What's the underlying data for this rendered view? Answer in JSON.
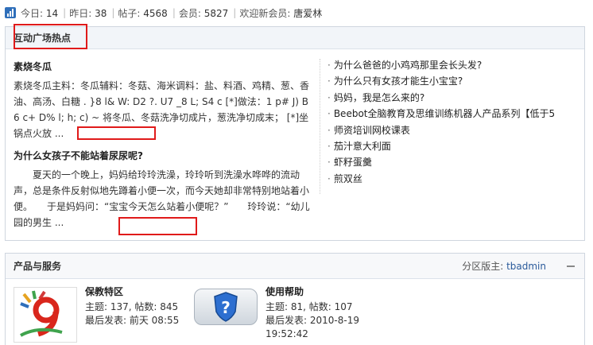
{
  "stats": {
    "today_label": "今日:",
    "today_value": "14",
    "yesterday_label": "昨日:",
    "yesterday_value": "38",
    "posts_label": "帖子:",
    "posts_value": "4568",
    "members_label": "会员:",
    "members_value": "5827",
    "welcome_label": "欢迎新会员:",
    "new_member": "唐爱林"
  },
  "hot": {
    "title": "互动广场热点",
    "post1": {
      "title": "素烧冬瓜",
      "body": "素烧冬瓜主料：冬瓜辅料：冬菇、海米调料：盐、料酒、鸡精、葱、香油、高汤、白糖 . }8 l& W: D2 ?. U7 _8 L; S4 c [*]做法：1 p# J) B6 c+ D% l; h; c) ~ 将冬瓜、冬菇洗净切成片，葱洗净切成末； [*]坐锅点火放 ..."
    },
    "post2": {
      "title": "为什么女孩子不能站着尿尿呢?",
      "body": "　　夏天的一个晚上，妈妈给玲玲洗澡，玲玲听到洗澡水哗哗的流动声，总是条件反射似地先蹲着小便一次，而今天她却非常特别地站着小便。　　于是妈妈问：“宝宝今天怎么站着小便呢？”　　玲玲说：“幼儿园的男生 ..."
    },
    "links": [
      "为什么爸爸的小鸡鸡那里会长头发?",
      "为什么只有女孩才能生小宝宝?",
      "妈妈，我是怎么来的?",
      "Beebot全脑教育及思维训练机器人产品系列【低于5",
      "师资培训网校课表",
      "茄汁意大利面",
      "虾籽蛋羹",
      "煎双丝"
    ]
  },
  "products": {
    "title": "产品与服务",
    "moderator_label": "分区版主:",
    "moderator_name": "tbadmin",
    "forums": [
      {
        "name": "保教特区",
        "stats": "主题: 137, 帖数: 845",
        "last": "最后发表: 前天 08:55",
        "icon": "nine-logo-icon"
      },
      {
        "name": "使用帮助",
        "stats": "主题: 81, 帖数: 107",
        "last": "最后发表: 2010-8-19",
        "last2": "19:52:42",
        "icon": "help-shield-icon"
      }
    ]
  },
  "colors": {
    "highlight": "#e01a1a",
    "link": "#2b5b9b",
    "header_bg": "#f2f5f9"
  }
}
